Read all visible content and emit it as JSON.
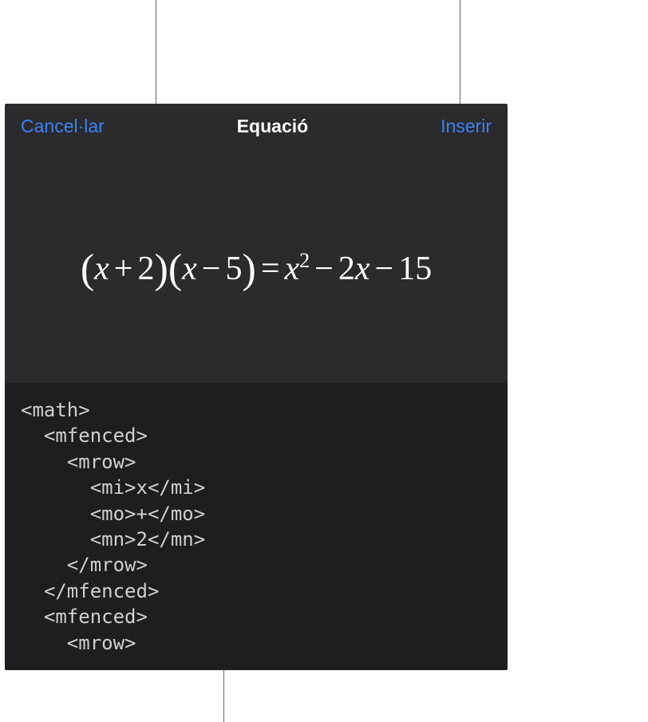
{
  "header": {
    "cancel_label": "Cancel·lar",
    "title": "Equació",
    "insert_label": "Inserir"
  },
  "equation": {
    "lhs_factor1_var": "x",
    "lhs_factor1_op": "+",
    "lhs_factor1_num": "2",
    "lhs_factor2_var": "x",
    "lhs_factor2_op": "−",
    "lhs_factor2_num": "5",
    "eq": "=",
    "rhs_t1_var": "x",
    "rhs_t1_exp": "2",
    "rhs_op1": "−",
    "rhs_t2_coef": "2",
    "rhs_t2_var": "x",
    "rhs_op2": "−",
    "rhs_t3": "15"
  },
  "code": "<math>\n  <mfenced>\n    <mrow>\n      <mi>x</mi>\n      <mo>+</mo>\n      <mn>2</mn>\n    </mrow>\n  </mfenced>\n  <mfenced>\n    <mrow>"
}
